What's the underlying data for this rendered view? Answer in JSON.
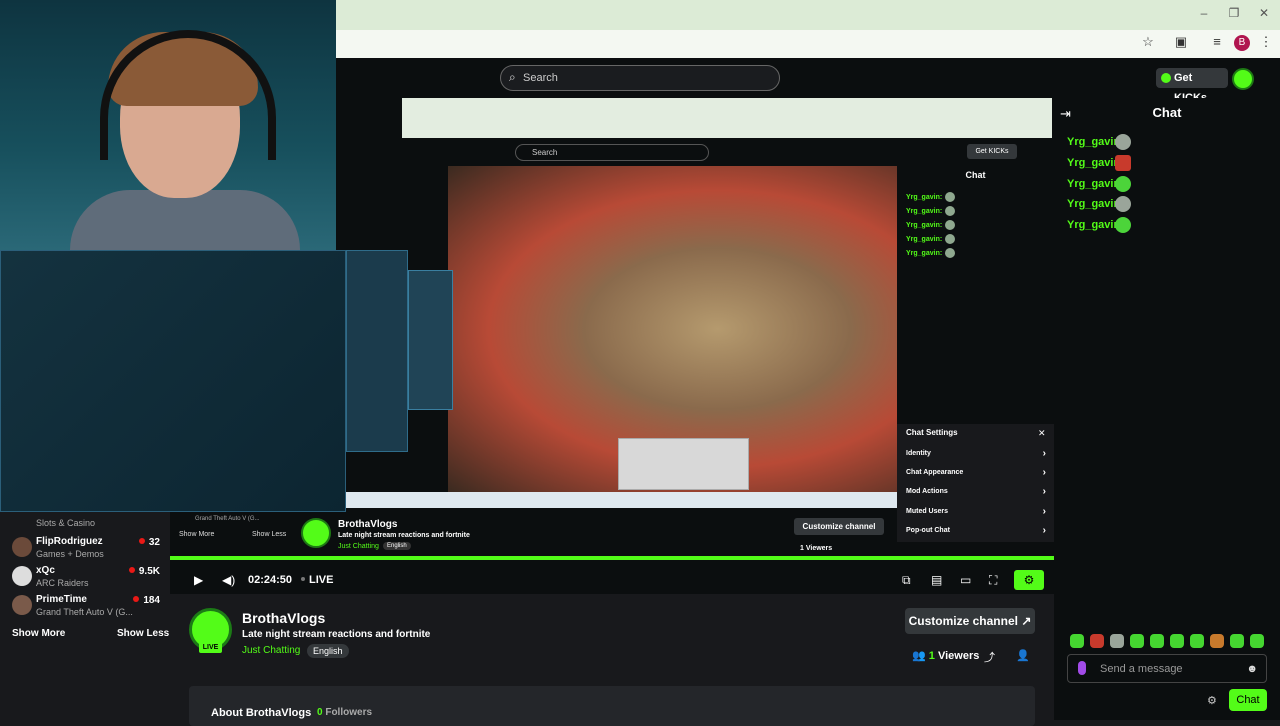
{
  "browser": {
    "profile_initial": "B"
  },
  "header": {
    "search_placeholder": "Search",
    "get_kicks_label": "Get KICKs"
  },
  "chat": {
    "title": "Chat",
    "messages": [
      {
        "user": "Yrg_gavin:"
      },
      {
        "user": "Yrg_gavin:"
      },
      {
        "user": "Yrg_gavin:"
      },
      {
        "user": "Yrg_gavin:"
      },
      {
        "user": "Yrg_gavin:"
      }
    ],
    "input_placeholder": "Send a message",
    "send_label": "Chat"
  },
  "sidebar": {
    "items": [
      {
        "name": "",
        "category": "Slots & Casino",
        "count": ""
      },
      {
        "name": "FlipRodriguez",
        "category": "Games + Demos",
        "count": "32"
      },
      {
        "name": "xQc",
        "category": "ARC Raiders",
        "count": "9.5K"
      },
      {
        "name": "PrimeTime",
        "category": "Grand Theft Auto V (G...",
        "count": "184"
      }
    ],
    "show_more": "Show More",
    "show_less": "Show Less"
  },
  "nested": {
    "search": "Search",
    "get_kicks": "Get KICKs",
    "chat_title": "Chat",
    "chat_user": "Yrg_gavin:",
    "settings_title": "Chat Settings",
    "settings_items": [
      "Identity",
      "Chat Appearance",
      "Mod Actions",
      "Muted Users",
      "Pop-out Chat"
    ],
    "channel_name": "BrothaVlogs",
    "stream_title": "Late night stream reactions and fortnite",
    "category": "Just Chatting",
    "language": "English",
    "customize": "Customize channel",
    "viewers": "1 Viewers",
    "show_more": "Show More",
    "show_less": "Show Less",
    "sidebar_cat": "Grand Theft Auto V (G..."
  },
  "player": {
    "time": "02:24:50",
    "live_label": "LIVE"
  },
  "channel": {
    "live_badge": "LIVE",
    "name": "BrothaVlogs",
    "title": "Late night stream reactions and fortnite",
    "category": "Just Chatting",
    "language": "English",
    "customize_label": "Customize channel",
    "viewer_count": "1",
    "viewer_label": "Viewers",
    "about_label": "About BrothaVlogs",
    "followers_count": "0",
    "followers_label": "Followers"
  }
}
